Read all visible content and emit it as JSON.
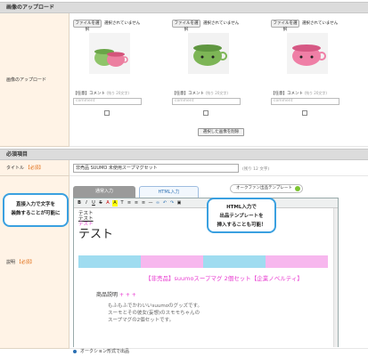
{
  "upload_section": {
    "header": "画像のアップロード",
    "row_label": "画像のアップロード",
    "columns": [
      {
        "file_button": "ファイルを選択",
        "file_status": "選択されていません",
        "comment_optional": "【任意】",
        "comment_label": "コメント",
        "comment_note": "(残り 20文字)",
        "comment_placeholder": "comment"
      },
      {
        "file_button": "ファイルを選択",
        "file_status": "選択されていません",
        "comment_optional": "【任意】",
        "comment_label": "コメント",
        "comment_note": "(残り 20文字)",
        "comment_placeholder": "comment"
      },
      {
        "file_button": "ファイルを選択",
        "file_status": "選択されていません",
        "comment_optional": "【任意】",
        "comment_label": "コメント",
        "comment_note": "(残り 20文字)",
        "comment_placeholder": "comment"
      }
    ],
    "delete_button": "選択した画像を削除"
  },
  "required_section": {
    "header": "必須項目",
    "title_label": "タイトル",
    "required_tag": "【必須】",
    "title_value": "非売品 SUUMO 未使用スープマグセット",
    "title_note": "(残り 12 文字)",
    "desc_label": "説明",
    "tab_plain": "通常入力",
    "tab_html": "HTML入力",
    "template_button": "オークファン出品テンプレート",
    "editor": {
      "line1": "テスト",
      "line2": "テスト",
      "line3": "テスト",
      "line4": "テスト",
      "product_title": "【非売品】suumoスープマグ 2個セット【企業ノベルティ】",
      "section_heading": "商品説明",
      "section_plus": "+ + +",
      "desc_line1": "もふもふでかわいいsuumoのグッズです。",
      "desc_line2": "スーモとその彼女(妄想)のスモモちゃんの",
      "desc_line3": "スープマグの2個セットです。"
    },
    "callout_left": "直接入力で文字を\n装飾することが可能に",
    "callout_right": "HTML入力で\n出品テンプレートを\n挿入することも可能！"
  },
  "footer_option": "オークション形式で出品",
  "colors": {
    "required": "#e06a10",
    "accent_blue": "#3aa0e0",
    "pink": "#e83ad0",
    "stripe_cyan": "#9fdcf0",
    "stripe_pink": "#f7b7ee"
  },
  "toolbar_icons": [
    "bold-icon",
    "italic-icon",
    "underline-icon",
    "strike-icon",
    "font-color-icon",
    "bg-color-icon",
    "font-size-icon",
    "align-left-icon",
    "align-center-icon",
    "align-right-icon",
    "hr-icon",
    "link-icon",
    "undo-icon",
    "redo-icon",
    "image-icon"
  ]
}
